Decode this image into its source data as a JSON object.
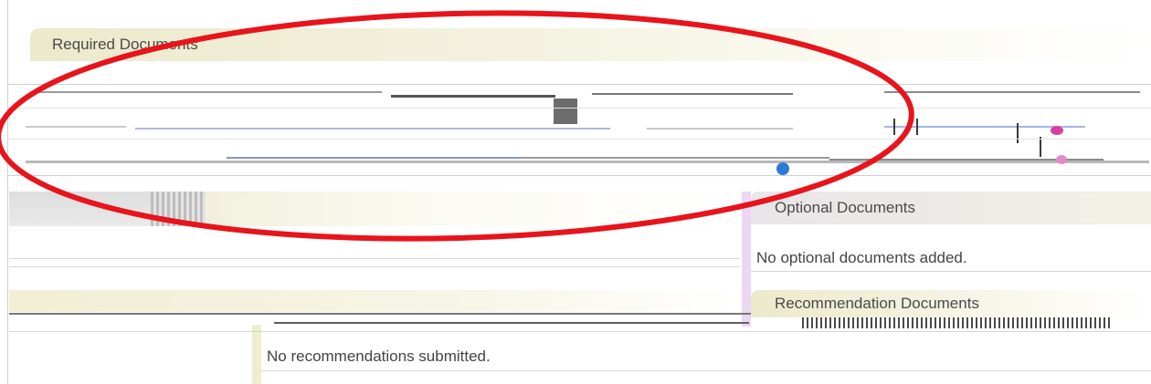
{
  "sections": {
    "required": {
      "title": "Required Documents"
    },
    "optional": {
      "title": "Optional Documents",
      "empty_message": "No optional documents added."
    },
    "recommendation": {
      "title": "Recommendation Documents",
      "empty_message": "No recommendations submitted."
    }
  },
  "colors": {
    "annotation_ellipse": "#e8141c",
    "header_tint": "#ece9cc",
    "optional_header_tint": "#e9e6e9",
    "pink_accent": "#ecd7f2"
  }
}
